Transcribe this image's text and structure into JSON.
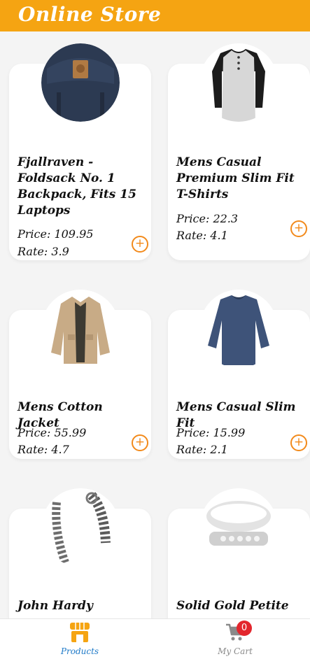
{
  "app": {
    "title": "Online Store"
  },
  "products": [
    {
      "title": "Fjallraven - Foldsack No. 1 Backpack, Fits 15 Laptops",
      "price": "Price: 109.95",
      "rate": "Rate: 3.9",
      "icon": "backpack-icon"
    },
    {
      "title": "Mens Casual Premium Slim Fit T-Shirts",
      "price": "Price: 22.3",
      "rate": "Rate: 4.1",
      "icon": "tshirt-icon"
    },
    {
      "title": "Mens Cotton Jacket",
      "price": "Price: 55.99",
      "rate": "Rate: 4.7",
      "icon": "jacket-icon"
    },
    {
      "title": "Mens Casual Slim Fit",
      "price": "Price: 15.99",
      "rate": "Rate: 2.1",
      "icon": "longsleeve-shirt-icon"
    },
    {
      "title": "John Hardy",
      "price": "",
      "rate": "",
      "icon": "bracelet-icon"
    },
    {
      "title": "Solid Gold Petite",
      "price": "",
      "rate": "",
      "icon": "ring-icon"
    }
  ],
  "add_symbol": "+",
  "bottom_nav": {
    "products_label": "Products",
    "cart_label": "My Cart",
    "cart_count": "0"
  },
  "colors": {
    "appbar": "#f5a412",
    "accent": "#f28a1b",
    "nav_active": "#1f7ac8",
    "nav_inactive": "#8a8a8a",
    "badge": "#e3262d"
  }
}
